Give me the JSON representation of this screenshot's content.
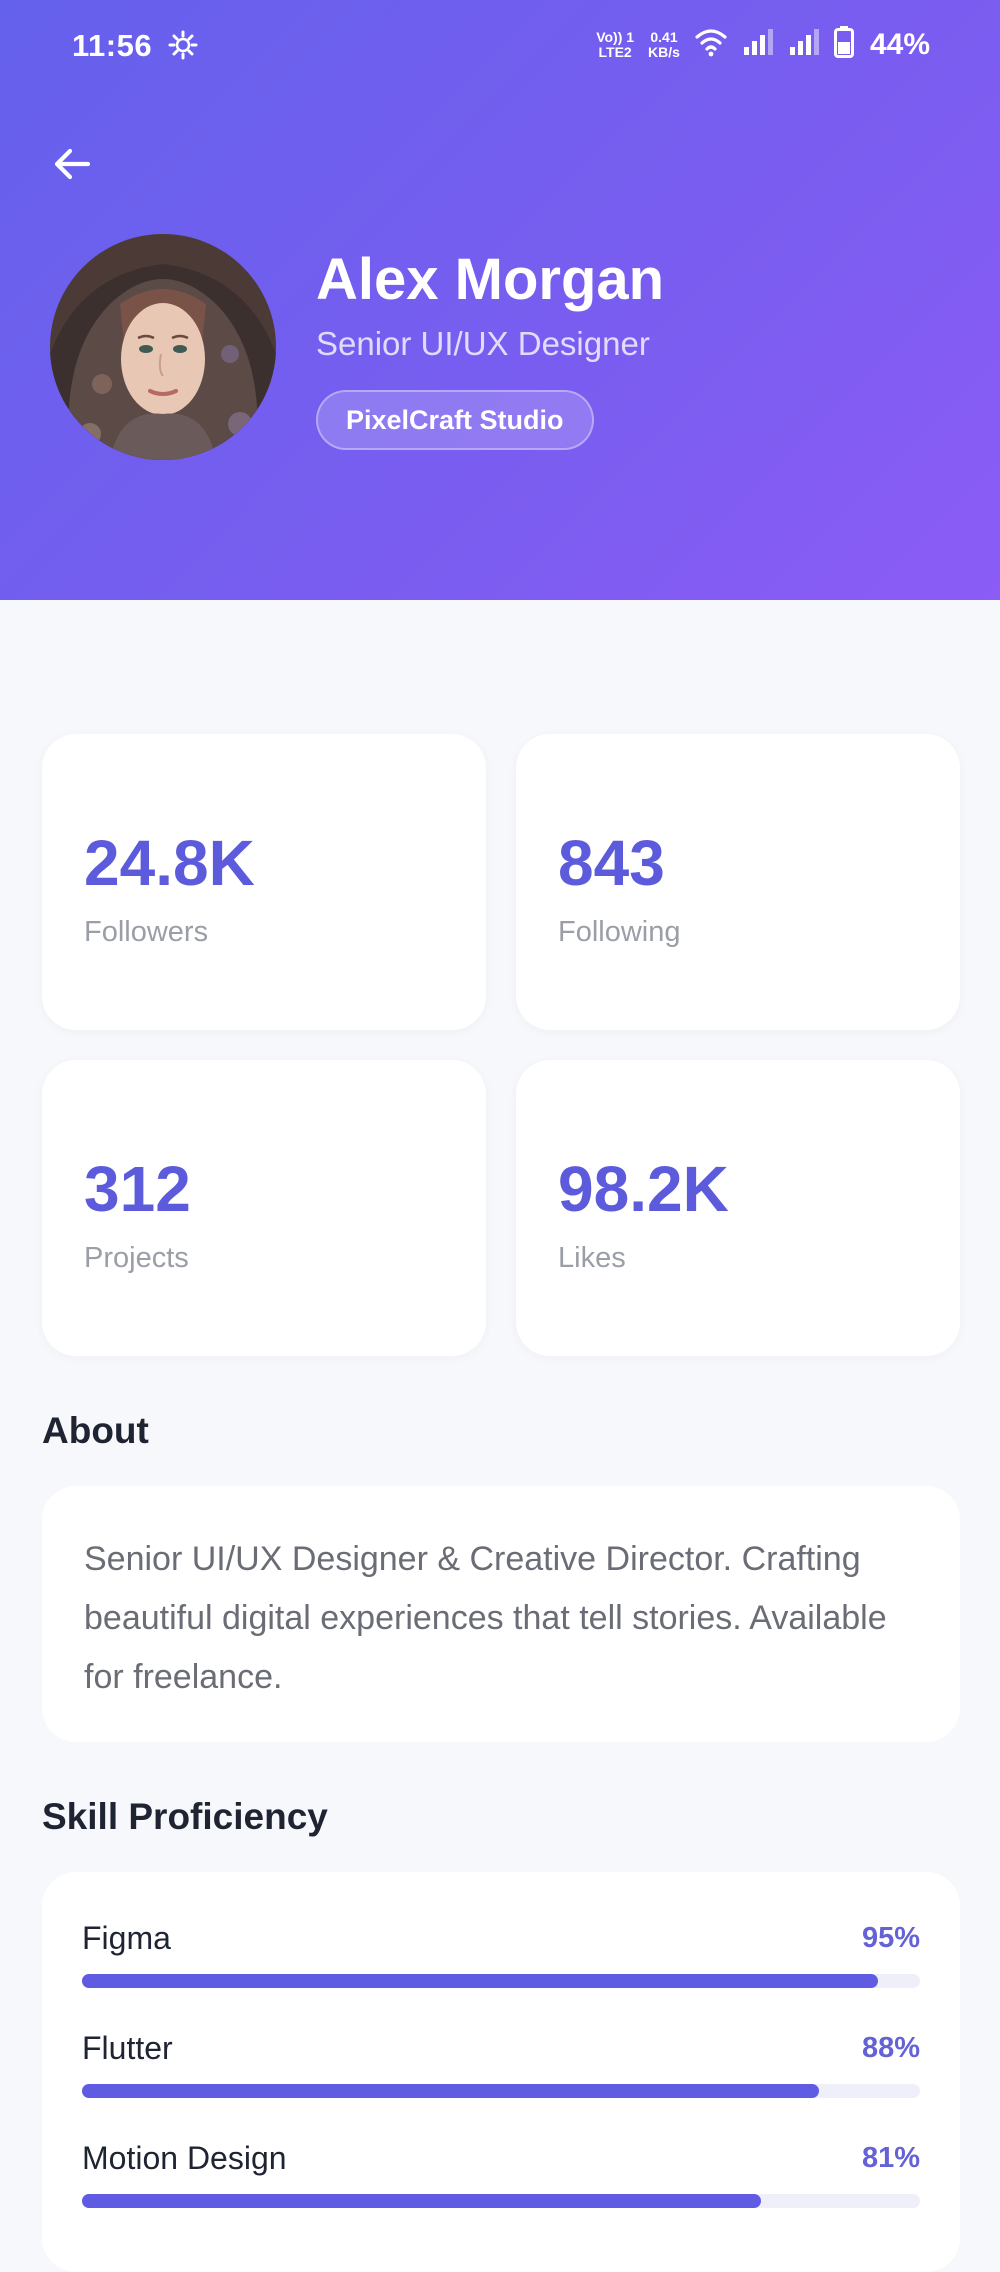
{
  "status_bar": {
    "time": "11:56",
    "network_top": "Vo)) 1",
    "network_bottom": "LTE2",
    "speed_value": "0.41",
    "speed_unit": "KB/s",
    "battery": "44%"
  },
  "profile": {
    "name": "Alex Morgan",
    "role": "Senior UI/UX Designer",
    "company": "PixelCraft Studio"
  },
  "stats": [
    {
      "value": "24.8K",
      "label": "Followers"
    },
    {
      "value": "843",
      "label": "Following"
    },
    {
      "value": "312",
      "label": "Projects"
    },
    {
      "value": "98.2K",
      "label": "Likes"
    }
  ],
  "about": {
    "title": "About",
    "text": "Senior UI/UX Designer & Creative Director. Crafting beautiful digital experiences that tell stories. Available for freelance."
  },
  "skills": {
    "title": "Skill Proficiency",
    "items": [
      {
        "name": "Figma",
        "percent_label": "95%",
        "level": 0.95
      },
      {
        "name": "Flutter",
        "percent_label": "88%",
        "level": 0.88
      },
      {
        "name": "Motion Design",
        "percent_label": "81%",
        "level": 0.81
      }
    ]
  },
  "colors": {
    "header_gradient_start": "#6461ec",
    "header_gradient_end": "#8b5cf6",
    "accent": "#5b5bdc",
    "background": "#f7f8fb"
  },
  "icons": [
    "settings-icon",
    "wifi-icon",
    "signal-icon",
    "battery-icon",
    "arrow-back-icon"
  ]
}
